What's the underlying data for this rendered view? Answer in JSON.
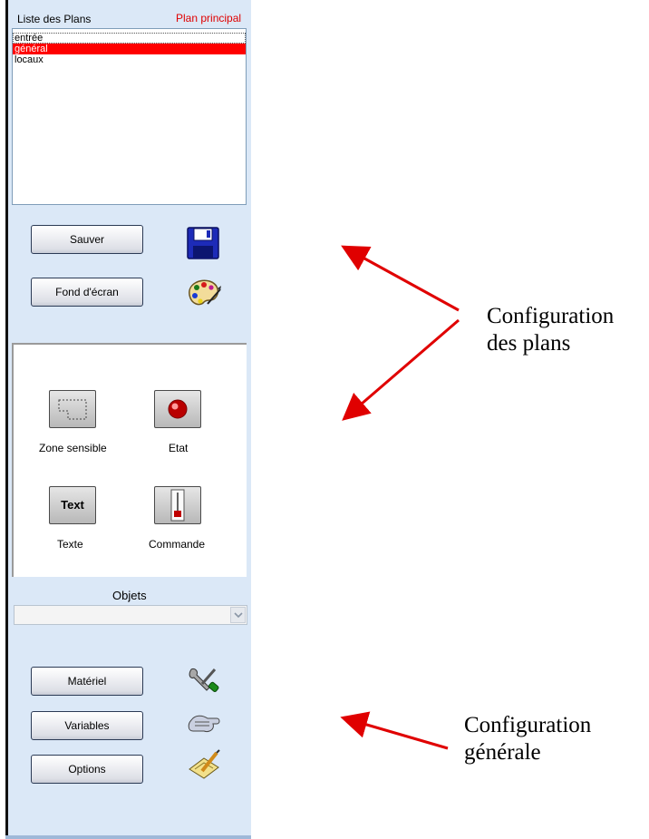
{
  "plans_panel": {
    "title": "Liste des Plans",
    "main_plan_label": "Plan principal",
    "items": [
      {
        "label": "entrée"
      },
      {
        "label": "général"
      },
      {
        "label": "locaux"
      }
    ],
    "selected_index": 1
  },
  "plan_buttons": {
    "save": "Sauver",
    "wallpaper": "Fond d'écran"
  },
  "objects": {
    "tools": [
      {
        "label": "Zone sensible",
        "icon": "sensitive-zone-icon"
      },
      {
        "label": "Etat",
        "icon": "state-led-icon"
      },
      {
        "label": "Texte",
        "icon": "text-icon",
        "button_text": "Text"
      },
      {
        "label": "Commande",
        "icon": "command-slider-icon"
      }
    ],
    "section_label": "Objets",
    "select_value": ""
  },
  "general_buttons": {
    "hardware": "Matériel",
    "variables": "Variables",
    "options": "Options"
  },
  "annotations": {
    "plans_line1": "Configuration",
    "plans_line2": "des plans",
    "general_line1": "Configuration",
    "general_line2": "générale"
  },
  "colors": {
    "panel_bg": "#dbe8f7",
    "selection": "#ff0000",
    "main_plan_text": "#e00000",
    "arrow": "#e00000"
  }
}
